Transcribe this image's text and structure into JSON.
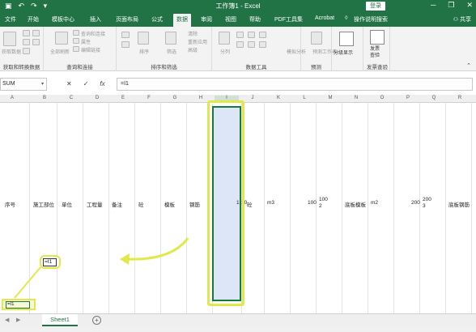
{
  "titlebar": {
    "title": "工作簿1  -  Excel",
    "login": "登录",
    "min": "─",
    "restore": "❐",
    "close": "✕"
  },
  "tabs": [
    "文件",
    "开始",
    "模板中心",
    "插入",
    "页面布局",
    "公式",
    "数据",
    "审阅",
    "视图",
    "帮助",
    "PDF工具集",
    "Acrobat",
    "操作说明搜索"
  ],
  "active_tab": "数据",
  "share": "共享",
  "ribbon": {
    "groups": [
      "获取和转换数据",
      "查询和连接",
      "排序和筛选",
      "数据工具",
      "预测",
      "发票查验"
    ],
    "outline_label": "分级显示",
    "invoice_label": "发票\n查验",
    "faded": [
      "获取数据",
      "全部刷新",
      "排序",
      "筛选",
      "分列",
      "模拟分析",
      "预测工作表"
    ],
    "faded_small": [
      "查询和连接",
      "属性",
      "编辑链接",
      "清除",
      "重新应用",
      "高级"
    ]
  },
  "formula_bar": {
    "name_box": "SUM",
    "cancel": "✕",
    "enter": "✓",
    "fx": "fx",
    "formula": "=I1"
  },
  "columns": [
    "A",
    "B",
    "C",
    "D",
    "E",
    "F",
    "G",
    "H",
    "I",
    "J",
    "K",
    "L",
    "M",
    "N",
    "O",
    "P",
    "Q",
    "R"
  ],
  "row1_cells": [
    {
      "text": "序号"
    },
    {
      "text": "施工部位"
    },
    {
      "text": "单位"
    },
    {
      "text": "工程量"
    },
    {
      "text": "备注"
    },
    {
      "text": "砼"
    },
    {
      "text": "模板"
    },
    {
      "text": "钢筋"
    },
    {
      "text": "1"
    },
    {
      "text": "10"
    },
    {
      "text": "砼"
    },
    {
      "text": "m3"
    },
    {
      "text": "100"
    },
    {
      "text": "100\n2"
    },
    {
      "text": "底板模板"
    },
    {
      "text": "m2"
    },
    {
      "text": "200"
    },
    {
      "text": "200\n3"
    },
    {
      "text": "底板钢筋"
    }
  ],
  "editing_cell_text": "=I1",
  "bottom_left_cell_text": "=I1",
  "sheet_tab": "Sheet1",
  "add_sheet": "+",
  "accent": "#217346",
  "highlight": "#e2e84a",
  "selection_fill": "#dde6f6"
}
